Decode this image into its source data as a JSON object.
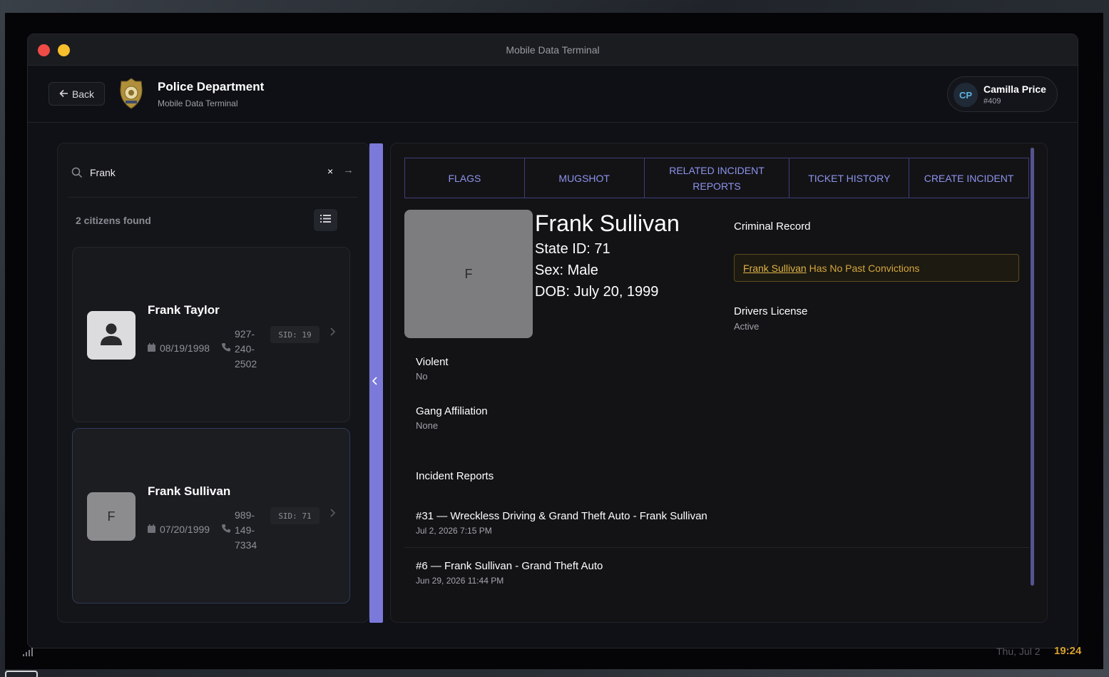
{
  "window": {
    "title": "Mobile Data Terminal"
  },
  "header": {
    "back_label": "Back",
    "department": "Police Department",
    "subtitle": "Mobile Data Terminal",
    "user": {
      "initials": "CP",
      "name": "Camilla Price",
      "badge": "#409"
    }
  },
  "search": {
    "value": "Frank",
    "placeholder": "",
    "clear": "×",
    "submit": "→",
    "results_label": "2 citizens found"
  },
  "citizens": [
    {
      "avatar": "",
      "name": "Frank Taylor",
      "dob": "08/19/1998",
      "phone_lines": [
        "927-",
        "240-",
        "2502"
      ],
      "sid": "SID: 19"
    },
    {
      "avatar": "F",
      "name": "Frank Sullivan",
      "dob": "07/20/1999",
      "phone_lines": [
        "989-",
        "149-",
        "7334"
      ],
      "sid": "SID: 71"
    }
  ],
  "tabs": [
    "FLAGS",
    "MUGSHOT",
    "RELATED INCIDENT REPORTS",
    "TICKET HISTORY",
    "CREATE INCIDENT"
  ],
  "profile": {
    "initial": "F",
    "name": "Frank Sullivan",
    "state_id": "State ID: 71",
    "sex": "Sex: Male",
    "dob": "DOB: July 20, 1999",
    "criminal_record_title": "Criminal Record",
    "conviction_name": "Frank Sullivan",
    "conviction_text": " Has No Past Convictions",
    "license_title": "Drivers License",
    "license_value": "Active",
    "violent_title": "Violent",
    "violent_value": "No",
    "gang_title": "Gang Affiliation",
    "gang_value": "None",
    "incidents_title": "Incident Reports",
    "incidents": [
      {
        "title": "#31 — Wreckless Driving & Grand Theft Auto - Frank Sullivan",
        "date": "Jul 2, 2026 7:15 PM"
      },
      {
        "title": "#6 — Frank Sullivan - Grand Theft Auto",
        "date": "Jun 29, 2026 11:44 PM"
      }
    ]
  },
  "taskbar": {
    "date": "Thu, Jul 2",
    "time": "19:24"
  },
  "colors": {
    "accent": "#7b79d9",
    "tab_text": "#8d93eb",
    "warning": "#d4a73e",
    "clock": "#d6a12f"
  }
}
